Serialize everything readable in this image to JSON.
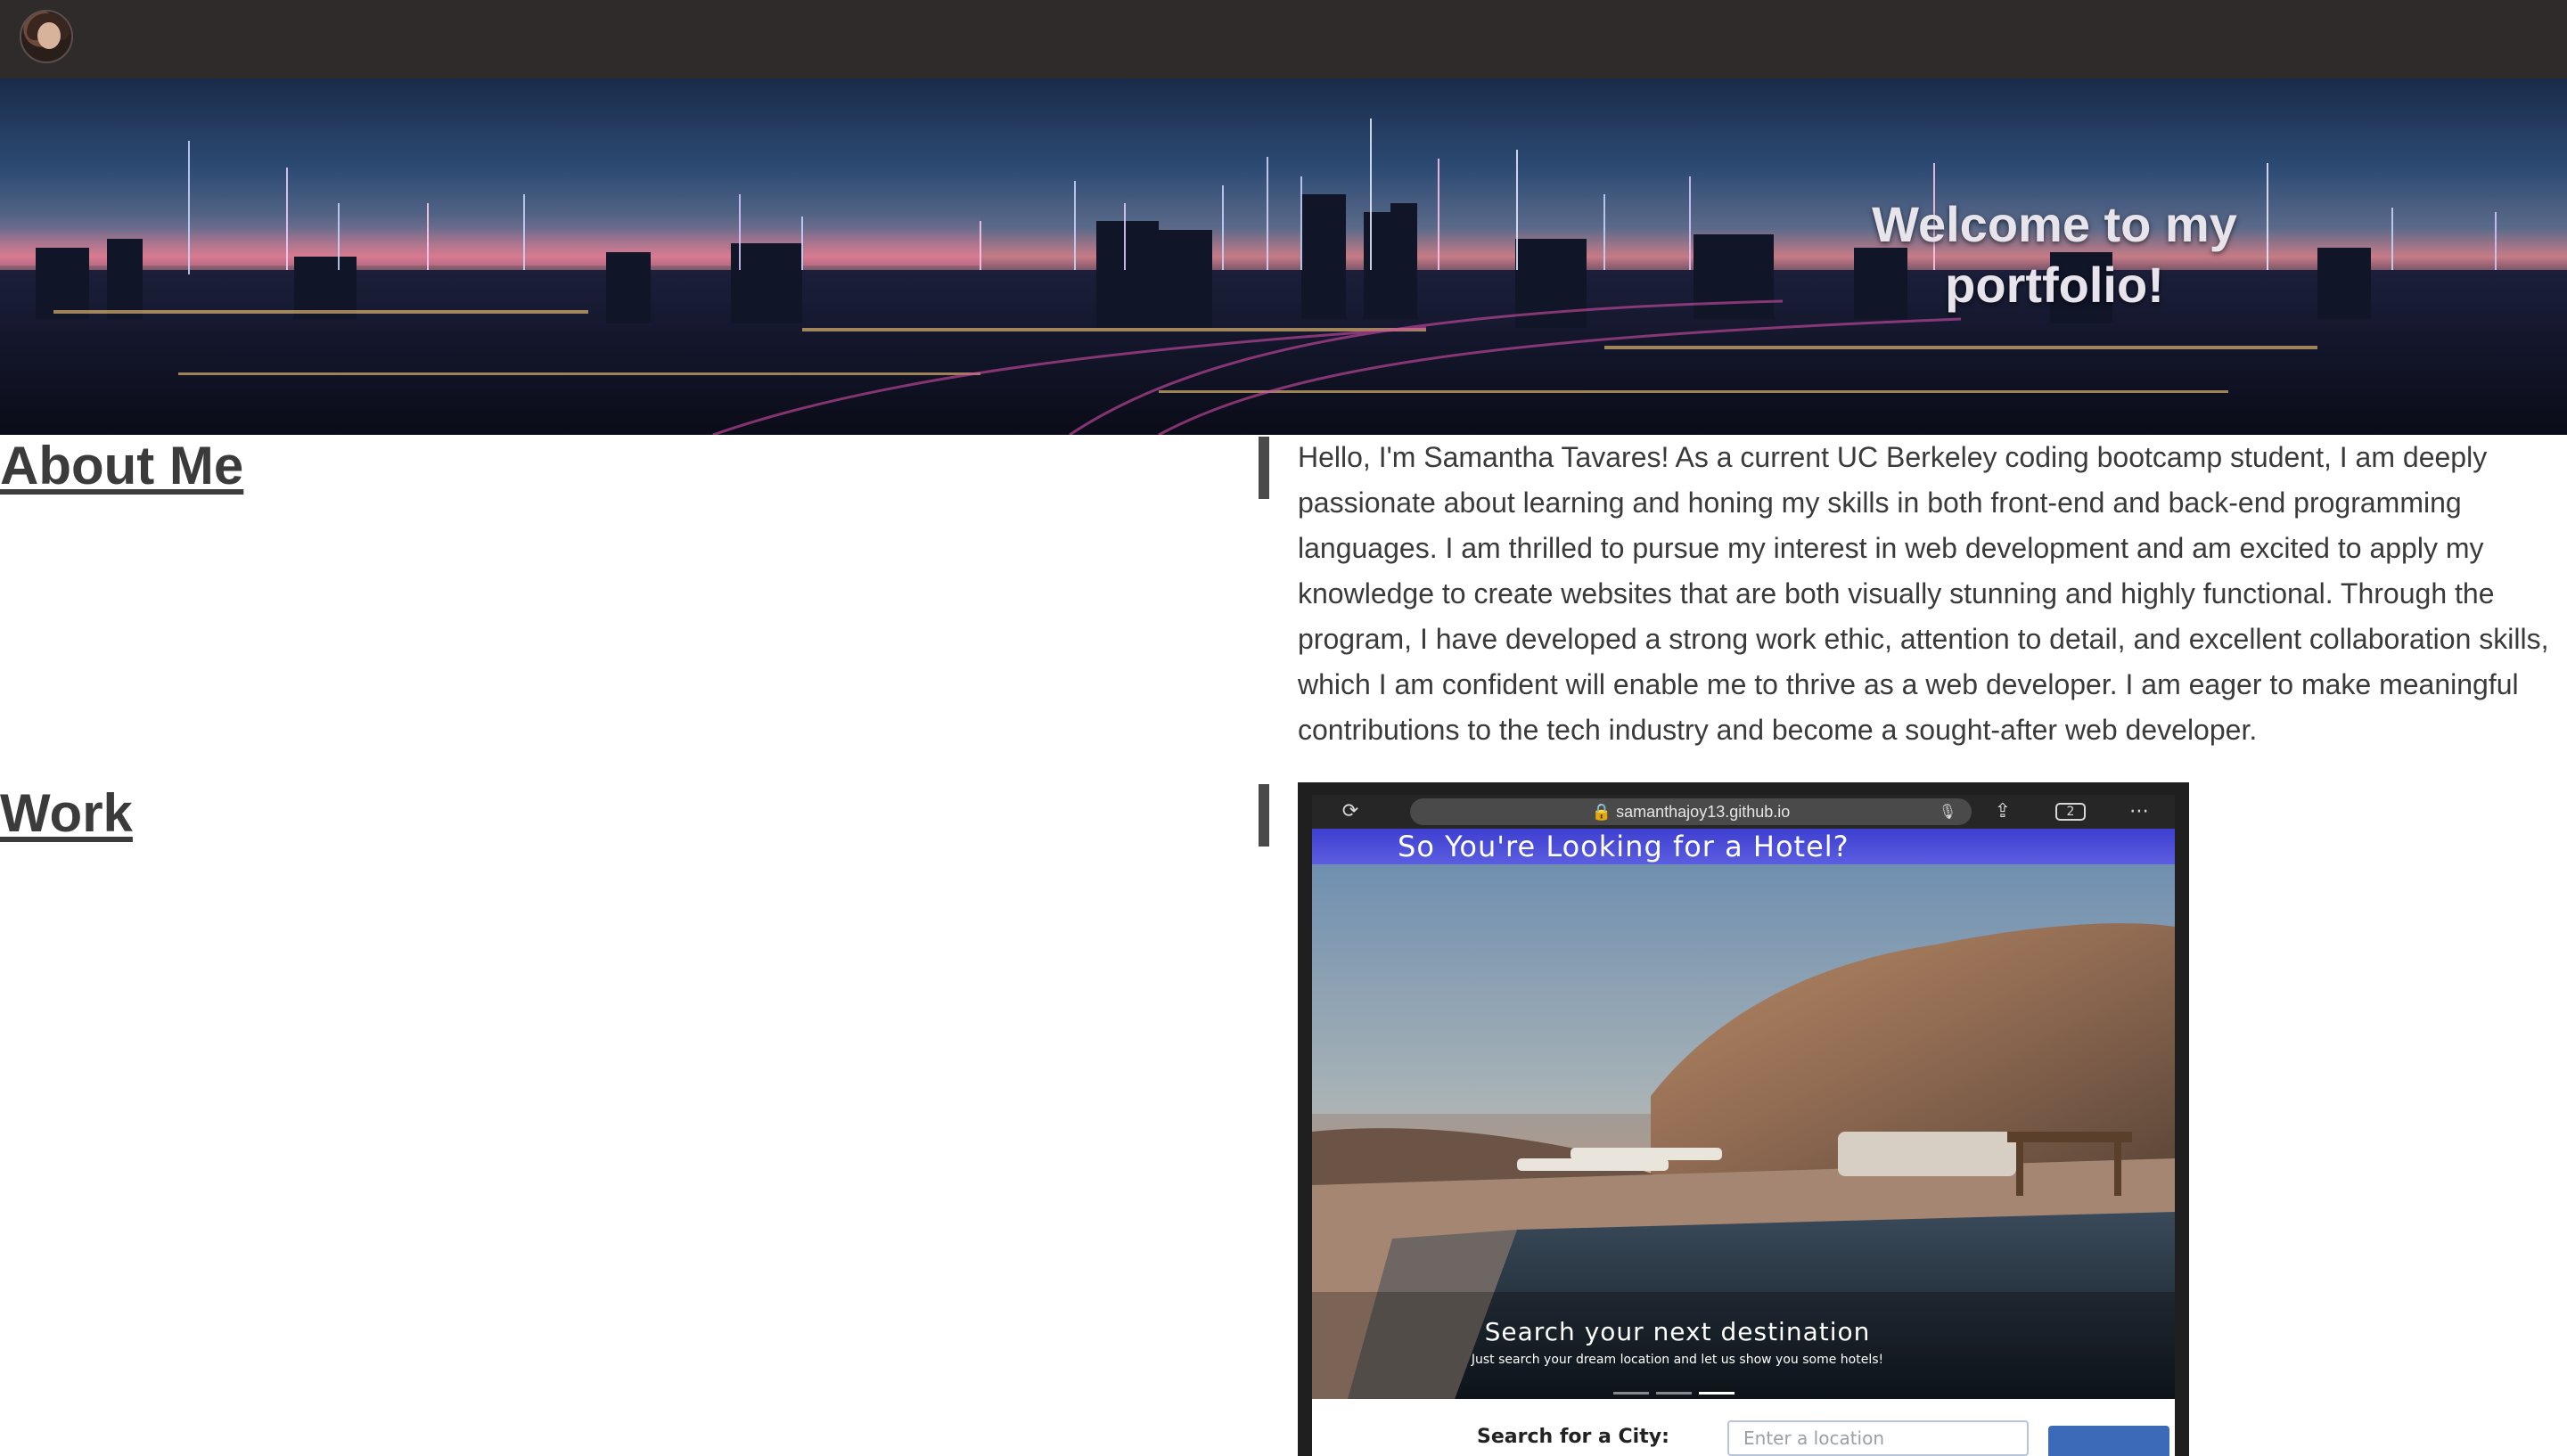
{
  "nav": {
    "avatar_alt": "profile photo"
  },
  "hero": {
    "title": "Welcome to my portfolio!"
  },
  "about": {
    "heading": "About Me",
    "body": "Hello, I'm Samantha Tavares! As a current UC Berkeley coding bootcamp student, I am deeply passionate about learning and honing my skills in both front-end and back-end programming languages. I am thrilled to pursue my interest in web development and am excited to apply my knowledge to create websites that are both visually stunning and highly functional. Through the program, I have developed a strong work ethic, attention to detail, and excellent collaboration skills, which I am confident will enable me to thrive as a web developer. I am eager to make meaningful contributions to the tech industry and become a sought-after web developer."
  },
  "work": {
    "heading": "Work",
    "project": {
      "url": "🔒 samanthajoy13.github.io",
      "tab_count": "2",
      "site_title": "So You're Looking for a Hotel?",
      "carousel_title": "Search your next destination",
      "carousel_subtitle": "Just search your dream location and let us show you some hotels!",
      "search_label": "Search for a City:",
      "search_placeholder": "Enter a location"
    }
  },
  "icons": {
    "reload": "reload-icon",
    "mic": "microphone-icon",
    "share": "share-icon",
    "tabs": "tabs-icon",
    "more": "more-icon"
  },
  "colors": {
    "nav_bg": "#2f2b2a",
    "heading_text": "#3b3b3b",
    "accent_bar": "#4a4a4a",
    "site_header_bg": "#3d3fd0",
    "search_button": "#3c69b8"
  }
}
